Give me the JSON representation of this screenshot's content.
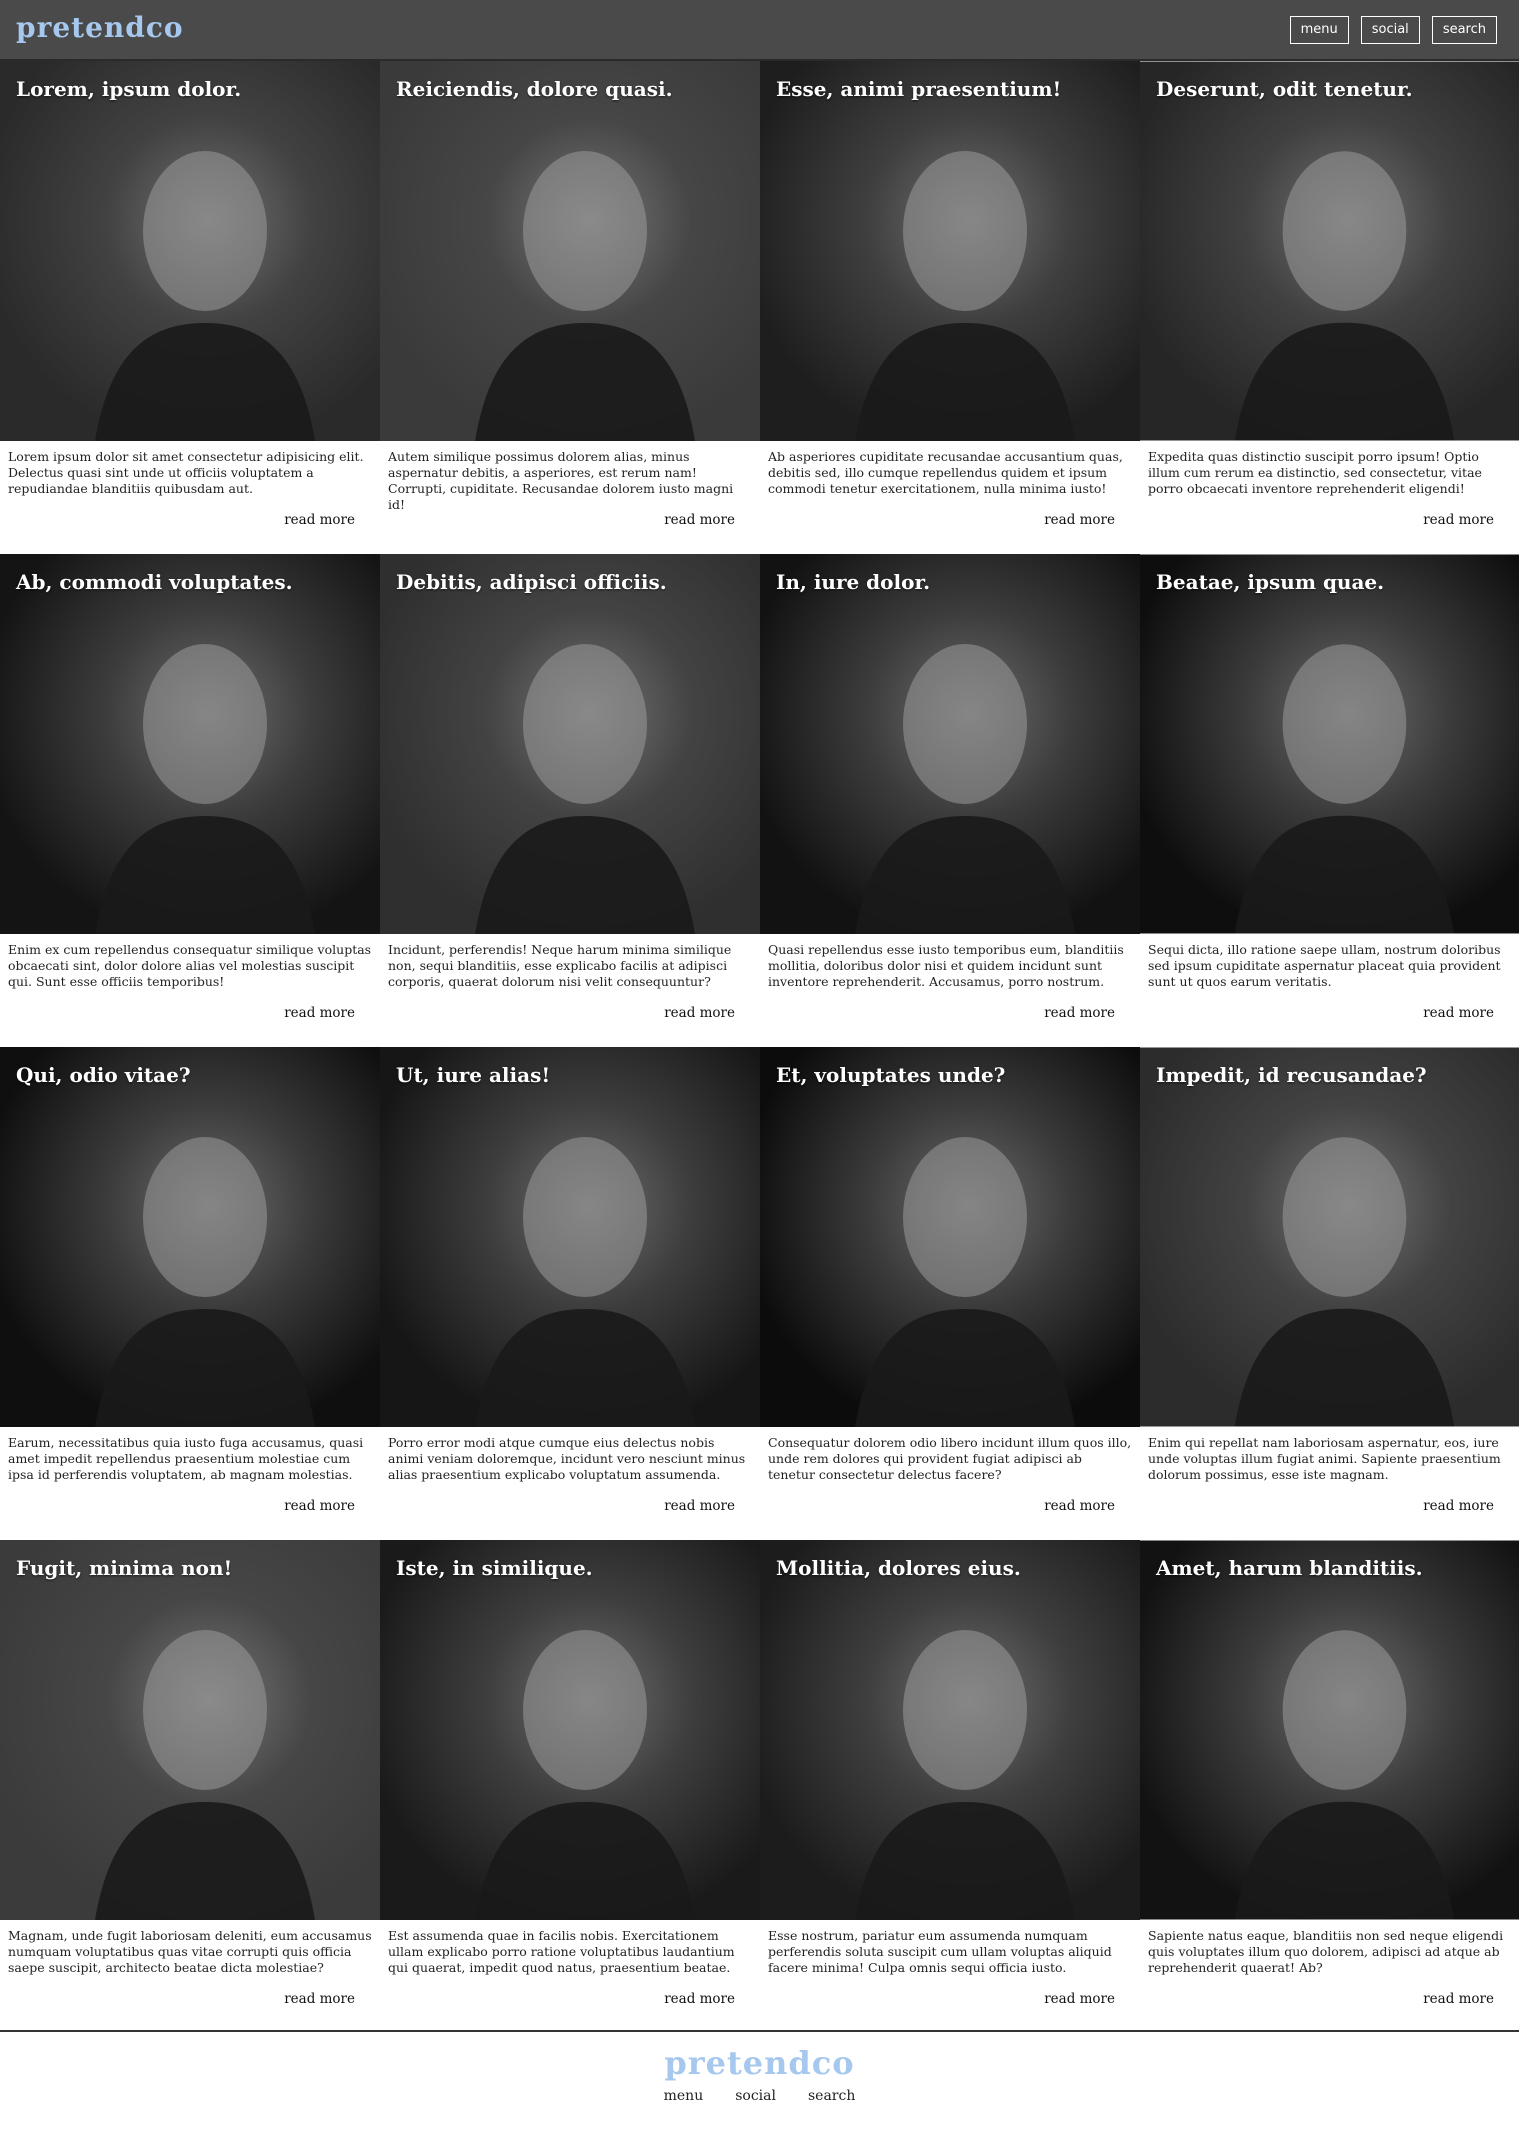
{
  "brand": {
    "name": "pretendco"
  },
  "nav": {
    "menu": "menu",
    "social": "social",
    "search": "search"
  },
  "read_more": "read more",
  "cards": [
    {
      "title": "Lorem, ipsum dolor.",
      "text": "Lorem ipsum dolor sit amet consectetur adipisicing elit. Delectus quasi sint unde ut officiis voluptatem a repudiandae blanditiis quibusdam aut.",
      "tone": "#2a2a2a"
    },
    {
      "title": "Reiciendis, dolore quasi.",
      "text": "Autem similique possimus dolorem alias, minus aspernatur debitis, a asperiores, est rerum nam! Corrupti, cupiditate. Recusandae dolorem iusto magni id!",
      "tone": "#3a3a3a"
    },
    {
      "title": "Esse, animi praesentium!",
      "text": "Ab asperiores cupiditate recusandae accusantium quas, debitis sed, illo cumque repellendus quidem et ipsum commodi tenetur exercitationem, nulla minima iusto!",
      "tone": "#1e1e1e"
    },
    {
      "title": "Deserunt, odit tenetur.",
      "text": "Expedita quas distinctio suscipit porro ipsum! Optio illum cum rerum ea distinctio, sed consectetur, vitae porro obcaecati inventore reprehenderit eligendi!",
      "tone": "#262626"
    },
    {
      "title": "Ab, commodi voluptates.",
      "text": "Enim ex cum repellendus consequatur similique voluptas obcaecati sint, dolor dolore alias vel molestias suscipit qui. Sunt esse officiis temporibus!",
      "tone": "#141414"
    },
    {
      "title": "Debitis, adipisci officiis.",
      "text": "Incidunt, perferendis! Neque harum minima similique non, sequi blanditiis, esse explicabo facilis at adipisci corporis, quaerat dolorum nisi velit consequuntur?",
      "tone": "#2f2f2f"
    },
    {
      "title": "In, iure dolor.",
      "text": "Quasi repellendus esse iusto temporibus eum, blanditiis mollitia, doloribus dolor nisi et quidem incidunt sunt inventore reprehenderit. Accusamus, porro nostrum.",
      "tone": "#121212"
    },
    {
      "title": "Beatae, ipsum quae.",
      "text": "Sequi dicta, illo ratione saepe ullam, nostrum doloribus sed ipsum cupiditate aspernatur placeat quia provident sunt ut quos earum veritatis.",
      "tone": "#0e0e0e"
    },
    {
      "title": "Qui, odio vitae?",
      "text": "Earum, necessitatibus quia iusto fuga accusamus, quasi amet impedit repellendus praesentium molestiae cum ipsa id perferendis voluptatem, ab magnam molestias.",
      "tone": "#0f0f0f"
    },
    {
      "title": "Ut, iure alias!",
      "text": "Porro error modi atque cumque eius delectus nobis animi veniam doloremque, incidunt vero nesciunt minus alias praesentium explicabo voluptatum assumenda.",
      "tone": "#161616"
    },
    {
      "title": "Et, voluptates unde?",
      "text": "Consequatur dolorem odio libero incidunt illum quos illo, unde rem dolores qui provident fugiat adipisci ab tenetur consectetur delectus facere?",
      "tone": "#0c0c0c"
    },
    {
      "title": "Impedit, id recusandae?",
      "text": "Enim qui repellat nam laboriosam aspernatur, eos, iure unde voluptas illum fugiat animi. Sapiente praesentium dolorum possimus, esse iste magnam.",
      "tone": "#2c2c2c"
    },
    {
      "title": "Fugit, minima non!",
      "text": "Magnam, unde fugit laboriosam deleniti, eum accusamus numquam voluptatibus quas vitae corrupti quis officia saepe suscipit, architecto beatae dicta molestiae?",
      "tone": "#3b3b3b"
    },
    {
      "title": "Iste, in similique.",
      "text": "Est assumenda quae in facilis nobis. Exercitationem ullam explicabo porro ratione voluptatibus laudantium qui quaerat, impedit quod natus, praesentium beatae.",
      "tone": "#1a1a1a"
    },
    {
      "title": "Mollitia, dolores eius.",
      "text": "Esse nostrum, pariatur eum assumenda numquam perferendis soluta suscipit cum ullam voluptas aliquid facere minima! Culpa omnis sequi officia iusto.",
      "tone": "#1c1c1c"
    },
    {
      "title": "Amet, harum blanditiis.",
      "text": "Sapiente natus eaque, blanditiis non sed neque eligendi quis voluptates illum quo dolorem, adipisci ad atque ab reprehenderit quaerat! Ab?",
      "tone": "#121212"
    }
  ],
  "footer": {
    "brand": "pretendco",
    "links": [
      "menu",
      "social",
      "search"
    ]
  }
}
